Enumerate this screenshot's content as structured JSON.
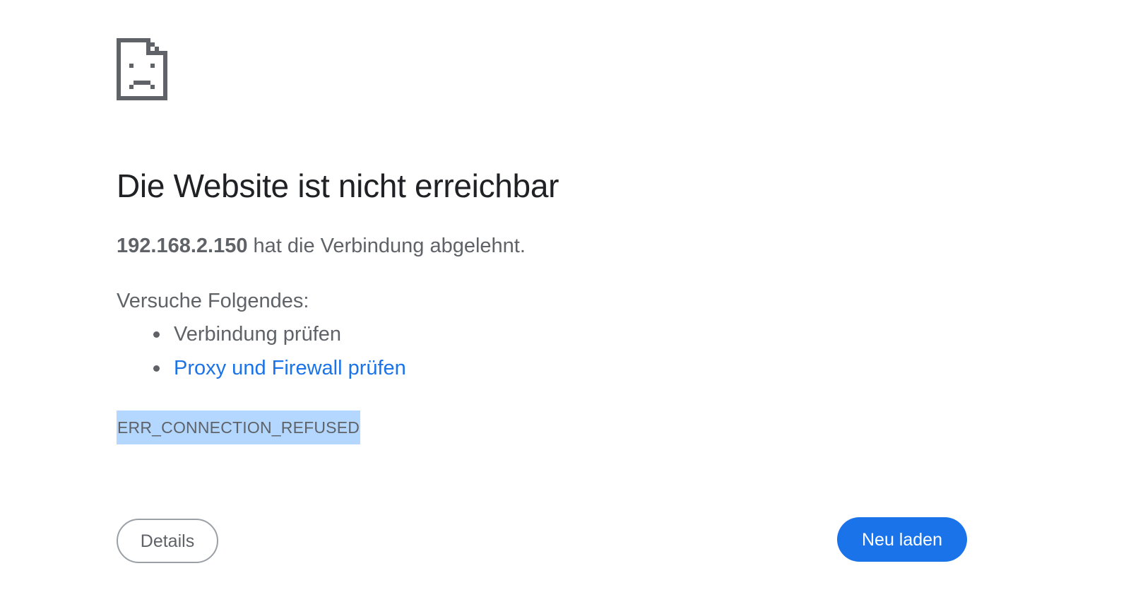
{
  "icon": {
    "name": "sad-page-icon",
    "color": "#5f6368"
  },
  "title": "Die Website ist nicht erreichbar",
  "summary": {
    "host": "192.168.2.150",
    "message": " hat die Verbindung abgelehnt."
  },
  "suggestions": {
    "heading": "Versuche Folgendes:",
    "items": [
      {
        "label": "Verbindung prüfen",
        "is_link": false
      },
      {
        "label": "Proxy und Firewall prüfen",
        "is_link": true
      }
    ]
  },
  "error_code": "ERR_CONNECTION_REFUSED",
  "buttons": {
    "details_label": "Details",
    "reload_label": "Neu laden"
  },
  "colors": {
    "text_primary": "#202124",
    "text_secondary": "#5f6368",
    "link": "#1a73e8",
    "accent": "#1a73e8",
    "selection": "#b3d7ff"
  }
}
